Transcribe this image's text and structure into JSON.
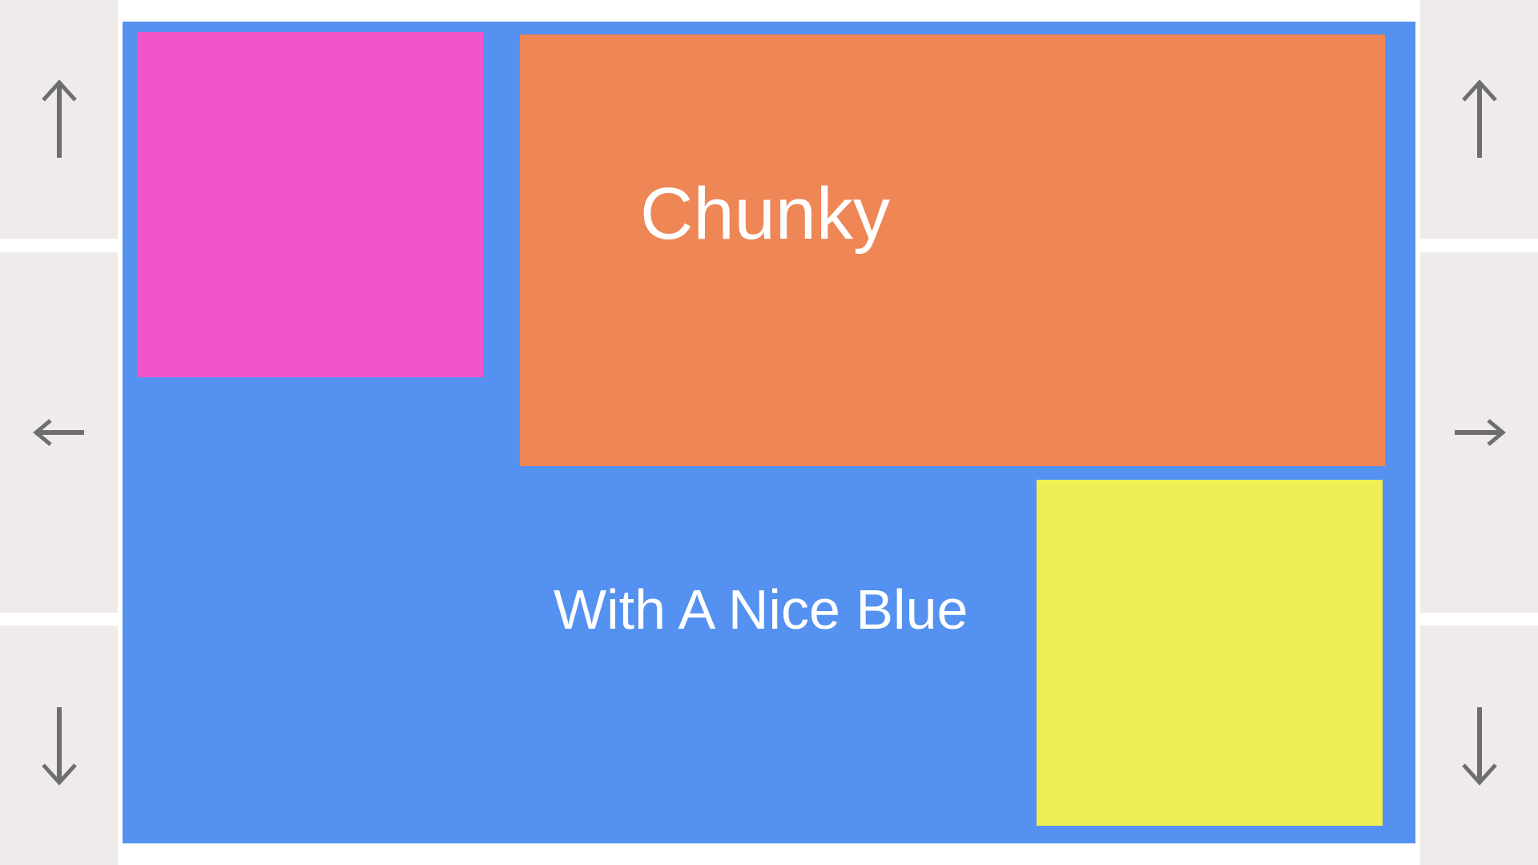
{
  "canvas": {
    "background_color": "#5591f1",
    "heading": "Chunky",
    "subheading": "With A Nice Blue",
    "blocks": {
      "pink": {
        "color": "#ef55c8"
      },
      "orange": {
        "color": "#ef8656"
      },
      "yellow": {
        "color": "#eeef55"
      }
    }
  },
  "navigation": {
    "left": {
      "up": {
        "icon": "arrow-up-icon",
        "glyph": "↑"
      },
      "left": {
        "icon": "arrow-left-icon",
        "glyph": "←"
      },
      "down": {
        "icon": "arrow-down-icon",
        "glyph": "↓"
      }
    },
    "right": {
      "up": {
        "icon": "arrow-up-icon",
        "glyph": "↑"
      },
      "right": {
        "icon": "arrow-right-icon",
        "glyph": "→"
      },
      "down": {
        "icon": "arrow-down-icon",
        "glyph": "↓"
      }
    },
    "button_color": "#efebea",
    "arrow_color": "#6e6e6e"
  }
}
